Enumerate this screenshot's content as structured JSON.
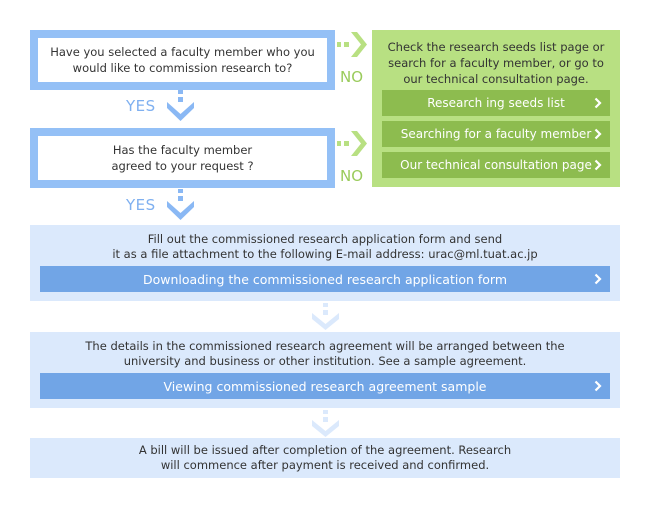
{
  "questions": [
    {
      "text_line1": "Have you selected a faculty member who you",
      "text_line2": "would like to commission research to?"
    },
    {
      "text_line1": "Has the faculty member",
      "text_line2": "agreed to your request ?"
    }
  ],
  "labels": {
    "yes": "YES",
    "no": "NO"
  },
  "no_panel": {
    "text_line1": "Check the research seeds list page or",
    "text_line2": "search for a faculty member, or go to",
    "text_line3": "our technical consultation page.",
    "buttons": [
      {
        "label": "Research ing seeds list"
      },
      {
        "label": "Searching for a faculty member"
      },
      {
        "label": "Our technical consultation page"
      }
    ]
  },
  "steps": [
    {
      "text_line1": "Fill out the commissioned research application form and send",
      "text_line2": "it as a file attachment to the following E-mail address: urac@ml.tuat.ac.jp",
      "button_label": "Downloading the commissioned research application form"
    },
    {
      "text_line1": "The details in the commissioned research agreement will be arranged between the",
      "text_line2": "university and business or other institution.  See a sample agreement.",
      "button_label": "Viewing commissioned research agreement sample"
    },
    {
      "text_line1": "A bill will be issued after completion of the agreement. Research",
      "text_line2": "will commence after payment is received and confirmed."
    }
  ],
  "colors": {
    "question_border": "#94c0f6",
    "green_panel": "#b8e082",
    "green_button": "#8dbc4f",
    "step_bg": "#dbe9fc",
    "blue_button": "#71a5e6",
    "yes_arrow": "#8ab8f4",
    "no_arrow": "#9acb5c"
  }
}
